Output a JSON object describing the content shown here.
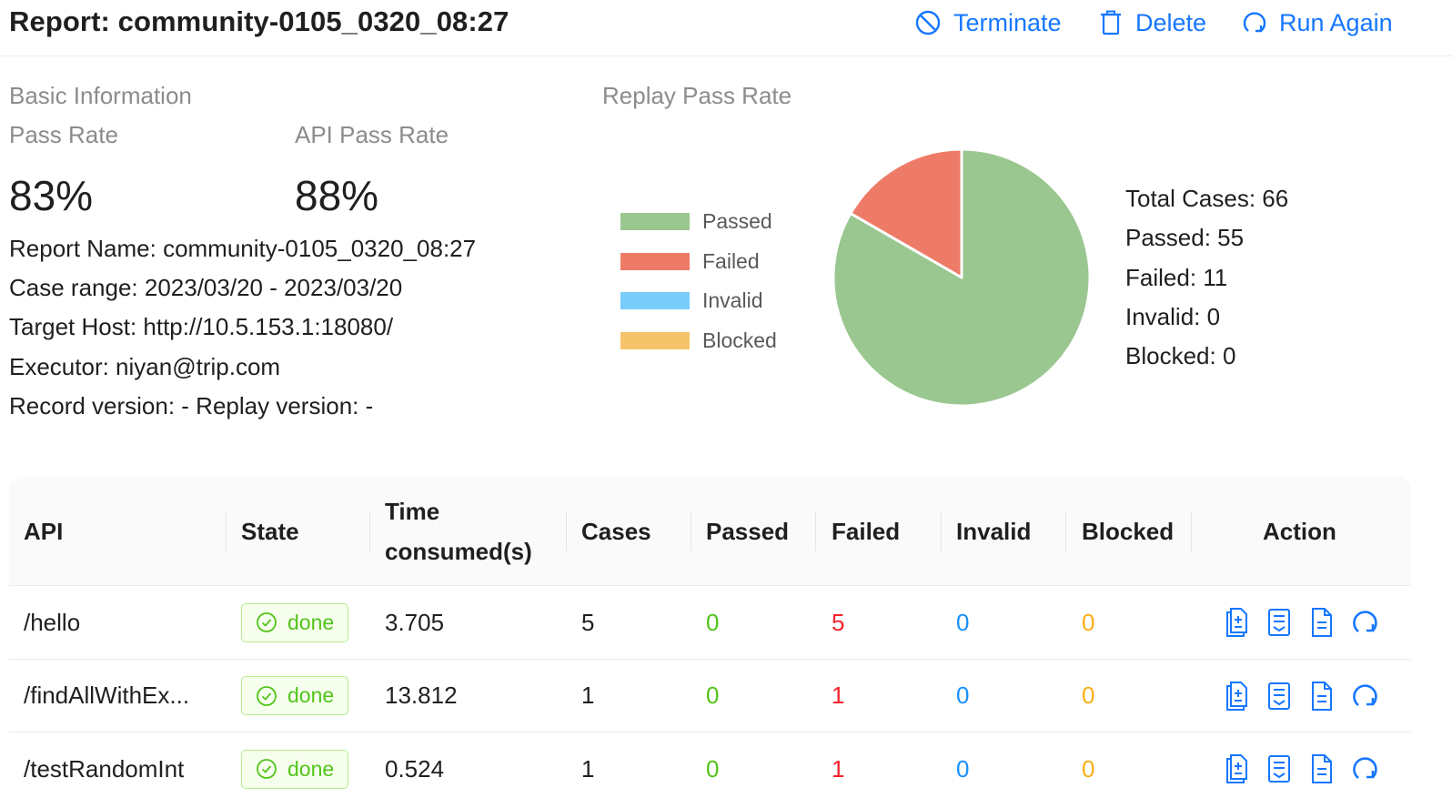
{
  "header": {
    "title": "Report: community-0105_0320_08:27",
    "terminate_label": "Terminate",
    "delete_label": "Delete",
    "run_again_label": "Run Again",
    "accent_color": "#1677ff"
  },
  "basic": {
    "section_title": "Basic Information",
    "pass_rate_label": "Pass Rate",
    "pass_rate_value": "83%",
    "api_pass_rate_label": "API Pass Rate",
    "api_pass_rate_value": "88%",
    "report_name": "Report Name: community-0105_0320_08:27",
    "case_range": "Case range: 2023/03/20 - 2023/03/20",
    "target_host": "Target Host: http://10.5.153.1:18080/",
    "executor": "Executor: niyan@trip.com",
    "versions": "Record version: - Replay version: -"
  },
  "replay": {
    "section_title": "Replay Pass Rate",
    "legend": [
      {
        "label": "Passed",
        "color": "#9ac790"
      },
      {
        "label": "Failed",
        "color": "#ee7b67"
      },
      {
        "label": "Invalid",
        "color": "#79cdfa"
      },
      {
        "label": "Blocked",
        "color": "#f5c36a"
      }
    ],
    "total_line": "Total Cases: 66",
    "passed_line": "Passed: 55",
    "failed_line": "Failed: 11",
    "invalid_line": "Invalid: 0",
    "blocked_line": "Blocked: 0"
  },
  "chart_data": {
    "type": "pie",
    "title": "",
    "categories": [
      "Passed",
      "Failed",
      "Invalid",
      "Blocked"
    ],
    "values": [
      55,
      11,
      0,
      0
    ],
    "colors": [
      "#9ac790",
      "#ee7b67",
      "#79cdfa",
      "#f5c36a"
    ],
    "legend_position": "left"
  },
  "table": {
    "columns": {
      "api": "API",
      "state": "State",
      "time_line1": "Time",
      "time_line2": "consumed(s)",
      "cases": "Cases",
      "passed": "Passed",
      "failed": "Failed",
      "invalid": "Invalid",
      "blocked": "Blocked",
      "action": "Action"
    },
    "status_colors": {
      "passed": "#52c41a",
      "failed": "#f5222d",
      "invalid": "#1890ff",
      "blocked": "#faad14"
    },
    "rows": [
      {
        "api": "/hello",
        "state": "done",
        "time": "3.705",
        "cases": "5",
        "passed": "0",
        "failed": "5",
        "invalid": "0",
        "blocked": "0"
      },
      {
        "api": "/findAllWithEx...",
        "state": "done",
        "time": "13.812",
        "cases": "1",
        "passed": "0",
        "failed": "1",
        "invalid": "0",
        "blocked": "0"
      },
      {
        "api": "/testRandomInt",
        "state": "done",
        "time": "0.524",
        "cases": "1",
        "passed": "0",
        "failed": "1",
        "invalid": "0",
        "blocked": "0"
      }
    ],
    "action_icons": [
      "diff-icon",
      "report-icon",
      "file-icon",
      "rerun-icon"
    ]
  }
}
